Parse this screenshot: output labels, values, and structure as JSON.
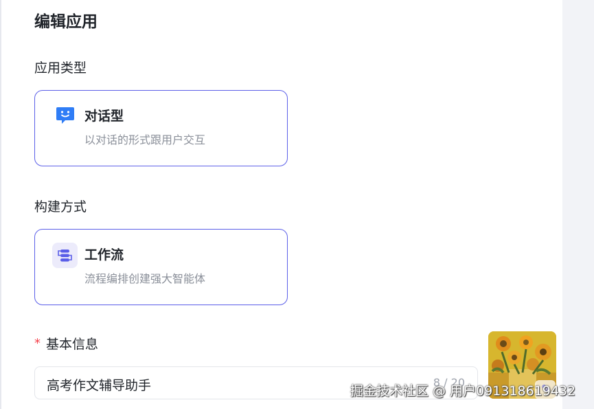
{
  "page": {
    "title": "编辑应用"
  },
  "app_type": {
    "label": "应用类型",
    "option": {
      "title": "对话型",
      "description": "以对话的形式跟用户交互",
      "icon": "chat-bubble-icon",
      "color": "#2f7df6"
    }
  },
  "build_mode": {
    "label": "构建方式",
    "option": {
      "title": "工作流",
      "description": "流程编排创建强大智能体",
      "icon": "workflow-icon",
      "color": "#5a5ee8"
    }
  },
  "basic_info": {
    "required_mark": "*",
    "label": "基本信息",
    "name_value": "高考作文辅导助手",
    "char_count": "8 / 20",
    "avatar_icon": "sunflower-painting-icon",
    "edit_icon": "edit-icon"
  },
  "watermark": "掘金技术社区 @ 用户091318619432",
  "colors": {
    "accent": "#5a5ee8",
    "chat_icon": "#2f7df6",
    "required": "#f5404a"
  }
}
